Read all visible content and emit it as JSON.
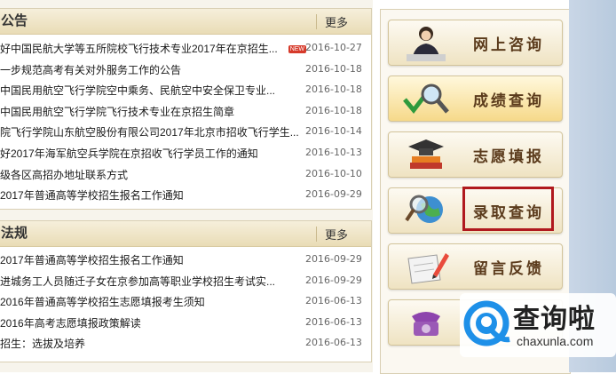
{
  "announcements": {
    "title": "公告",
    "more_label": "更多",
    "items": [
      {
        "title": "好中国民航大学等五所院校飞行技术专业2017年在京招生...",
        "date": "2016-10-27",
        "badge": "NEW"
      },
      {
        "title": "一步规范高考有关对外服务工作的公告",
        "date": "2016-10-18"
      },
      {
        "title": "中国民用航空飞行学院空中乘务、民航空中安全保卫专业...",
        "date": "2016-10-18"
      },
      {
        "title": "中国民用航空飞行学院飞行技术专业在京招生简章",
        "date": "2016-10-18"
      },
      {
        "title": "院飞行学院山东航空股份有限公司2017年北京市招收飞行学生...",
        "date": "2016-10-14"
      },
      {
        "title": "好2017年海军航空兵学院在京招收飞行学员工作的通知",
        "date": "2016-10-13"
      },
      {
        "title": "级各区高招办地址联系方式",
        "date": "2016-10-10"
      },
      {
        "title": "2017年普通高等学校招生报名工作通知",
        "date": "2016-09-29"
      }
    ]
  },
  "regulations": {
    "title": "法规",
    "more_label": "更多",
    "items": [
      {
        "title": "2017年普通高等学校招生报名工作通知",
        "date": "2016-09-29"
      },
      {
        "title": "进城务工人员随迁子女在京参加高等职业学校招生考试实...",
        "date": "2016-09-29"
      },
      {
        "title": "2016年普通高等学校招生志愿填报考生须知",
        "date": "2016-06-13"
      },
      {
        "title": "2016年高考志愿填报政策解读",
        "date": "2016-06-13"
      },
      {
        "title": "招生：选拔及培养",
        "date": "2016-06-13"
      }
    ]
  },
  "quick_links": [
    {
      "label": "网上咨询",
      "icon": "consultant-person-icon"
    },
    {
      "label": "成绩查询",
      "icon": "magnifier-check-icon"
    },
    {
      "label": "志愿填报",
      "icon": "books-cap-icon"
    },
    {
      "label": "录取查询",
      "icon": "globe-magnifier-icon"
    },
    {
      "label": "留言反馈",
      "icon": "pencil-paper-icon"
    },
    {
      "label": "",
      "icon": "telephone-icon"
    }
  ],
  "watermark": {
    "name": "查询啦",
    "domain": "chaxunla.com"
  },
  "colors": {
    "highlight_border": "#b0191e",
    "label_brown": "#5b3b1c",
    "panel_header": "#e9dcb6"
  }
}
